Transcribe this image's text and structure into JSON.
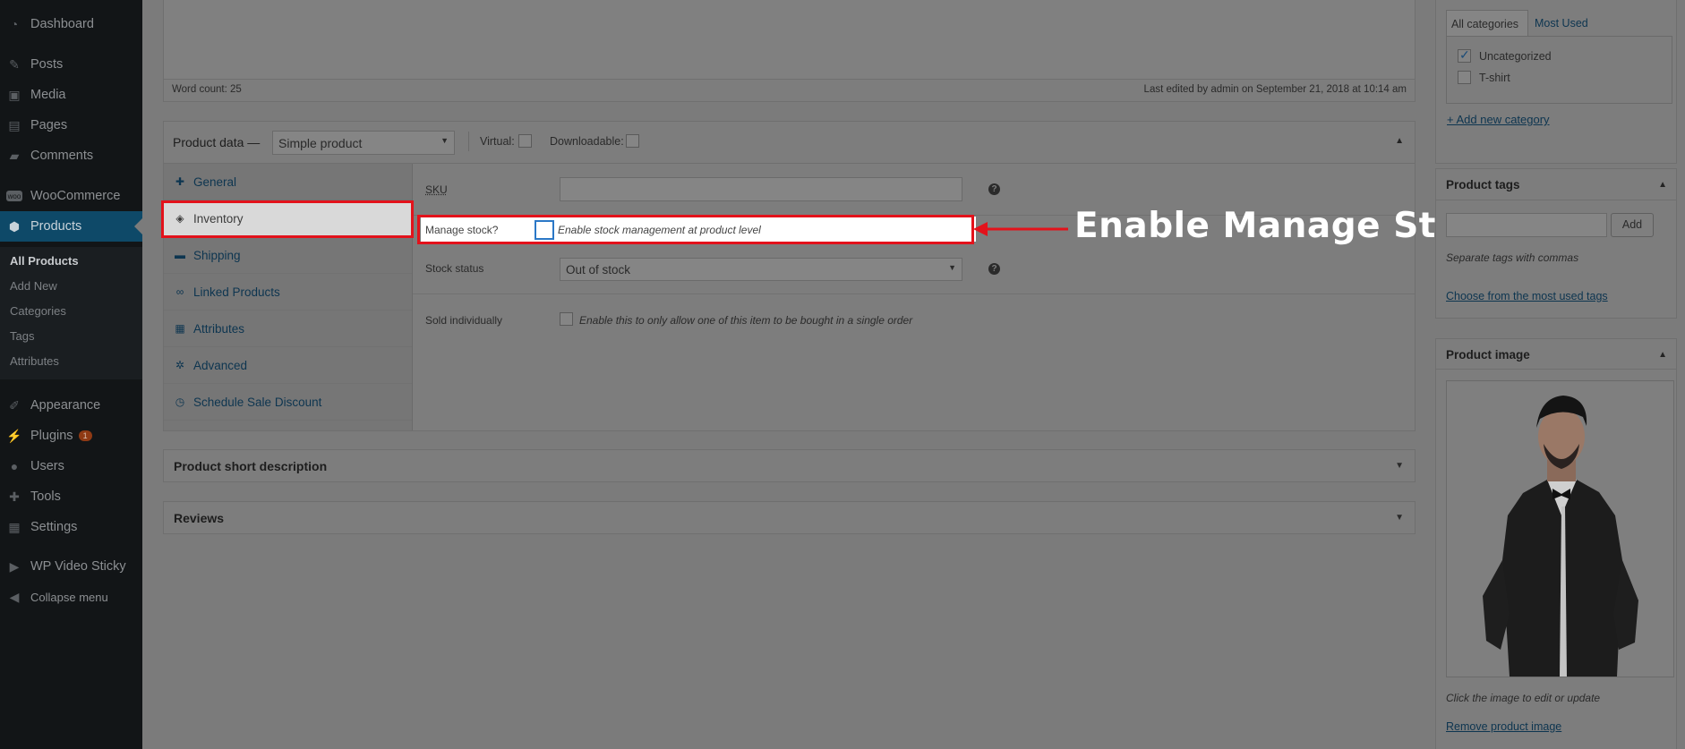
{
  "sidebar": {
    "items": [
      {
        "label": "Dashboard",
        "icon": "dashboard-icon"
      },
      {
        "label": "Posts",
        "icon": "pin-icon"
      },
      {
        "label": "Media",
        "icon": "media-icon"
      },
      {
        "label": "Pages",
        "icon": "pages-icon"
      },
      {
        "label": "Comments",
        "icon": "comments-icon"
      },
      {
        "label": "WooCommerce",
        "icon": "woocommerce-icon"
      },
      {
        "label": "Products",
        "icon": "products-icon"
      },
      {
        "label": "Appearance",
        "icon": "brush-icon"
      },
      {
        "label": "Plugins",
        "icon": "plugin-icon",
        "badge": "1"
      },
      {
        "label": "Users",
        "icon": "users-icon"
      },
      {
        "label": "Tools",
        "icon": "wrench-icon"
      },
      {
        "label": "Settings",
        "icon": "settings-icon"
      },
      {
        "label": "WP Video Sticky",
        "icon": "video-icon"
      },
      {
        "label": "Collapse menu",
        "icon": "collapse-icon"
      }
    ],
    "submenu": [
      "All Products",
      "Add New",
      "Categories",
      "Tags",
      "Attributes"
    ]
  },
  "editor": {
    "word_count": "Word count: 25",
    "last_edited": "Last edited by admin on September 21, 2018 at 10:14 am"
  },
  "product_data": {
    "title": "Product data —",
    "type_selected": "Simple product",
    "virtual_label": "Virtual:",
    "downloadable_label": "Downloadable:",
    "tabs": [
      "General",
      "Inventory",
      "Shipping",
      "Linked Products",
      "Attributes",
      "Advanced",
      "Schedule Sale Discount"
    ],
    "sku_label": "SKU",
    "sku_value": "",
    "manage_stock_label": "Manage stock?",
    "manage_stock_desc": "Enable stock management at product level",
    "stock_status_label": "Stock status",
    "stock_status_value": "Out of stock",
    "sold_individually_label": "Sold individually",
    "sold_individually_desc": "Enable this to only allow one of this item to be bought in a single order",
    "help_glyph": "?"
  },
  "short_description": {
    "title": "Product short description"
  },
  "reviews": {
    "title": "Reviews"
  },
  "categories": {
    "tabs": [
      "All categories",
      "Most Used"
    ],
    "items": [
      {
        "label": "Uncategorized",
        "checked": true
      },
      {
        "label": "T-shirt",
        "checked": false
      }
    ],
    "add_link": "+ Add new category"
  },
  "tags": {
    "title": "Product tags",
    "input_value": "",
    "add_button": "Add",
    "hint": "Separate tags with commas",
    "choose_link": "Choose from the most used tags"
  },
  "product_image": {
    "title": "Product image",
    "caption": "Click the image to edit or update",
    "remove_link": "Remove product image"
  },
  "annotation": {
    "text": "Enable Manage Stock",
    "color": "#e3121b"
  },
  "colors": {
    "sidebar_bg": "#121517",
    "active_menu": "#0e4968",
    "overlay_bg": "#7b7b7b",
    "highlight": "#e3121b"
  }
}
